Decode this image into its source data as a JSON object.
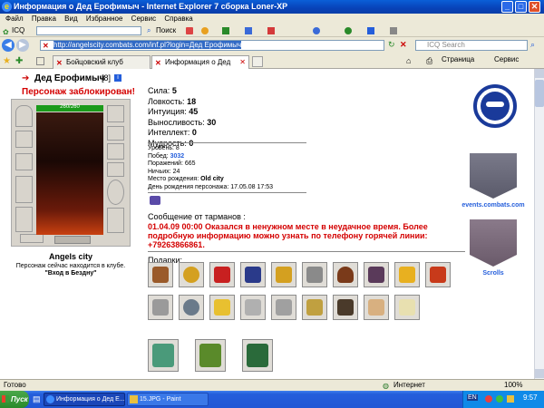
{
  "window": {
    "title": "Информация о Дед Ерофимыч - Internet Explorer 7 сборка Loner-XP"
  },
  "menu": [
    "Файл",
    "Правка",
    "Вид",
    "Избранное",
    "Сервис",
    "Справка"
  ],
  "toolbar": {
    "icq_label": "ICQ",
    "search_label": "Поиск"
  },
  "address": {
    "url": "http://angelscity.combats.com/inf.pl?login=Дед Ерофимыч",
    "search_placeholder": "ICQ Search"
  },
  "tabs": [
    {
      "label": "Бойцовский клуб"
    },
    {
      "label": "Информация о Дед Еро..."
    }
  ],
  "command_bar": {
    "page_label": "Страница",
    "tools_label": "Сервис"
  },
  "character": {
    "name": "Дед Ерофимыч",
    "level": "[8]",
    "blocked": "Персонаж заблокирован!",
    "hp": "260/260",
    "city": "Angels city",
    "location_prefix": "Персонаж сейчас находится в клубе.",
    "location": "\"Вход в Бездну\""
  },
  "stats": [
    {
      "label": "Сила:",
      "value": "5"
    },
    {
      "label": "Ловкость:",
      "value": "18"
    },
    {
      "label": "Интуиция:",
      "value": "45"
    },
    {
      "label": "Выносливость:",
      "value": "30"
    },
    {
      "label": "Интеллект:",
      "value": "0"
    },
    {
      "label": "Мудрость:",
      "value": "0"
    }
  ],
  "info": [
    {
      "label": "Уровень:",
      "value": "8"
    },
    {
      "label": "Побед:",
      "value": "3032"
    },
    {
      "label": "Поражений:",
      "value": "665"
    },
    {
      "label": "Ничьих:",
      "value": "24"
    },
    {
      "label": "Место рождения:",
      "value": "Old city"
    },
    {
      "label": "День рождения персонажа:",
      "value": "17.05.08 17:53"
    }
  ],
  "message": {
    "header": "Сообщение от тарманов :",
    "text": "01.04.09 00:00 Оказался в ненужном месте в неудачное время. Более подробную информацию можно узнать по телефону горячей линии: +79263866861."
  },
  "gifts_label": "Подарки:",
  "right_panel": {
    "link1": "events.combats.com",
    "link2": "Scrolls"
  },
  "status": {
    "left": "Готово",
    "zone": "Интернет",
    "zoom": "100%"
  },
  "taskbar": {
    "start": "Пуск",
    "items": [
      "Информация о Дед Е...",
      "15.JPG - Paint"
    ],
    "lang": "EN",
    "clock": "9:57"
  },
  "colors": {
    "blocked_red": "#d40000",
    "message_red": "#d40000",
    "hp_green": "#1a9a1a",
    "titlebar": "#0a52d0"
  }
}
